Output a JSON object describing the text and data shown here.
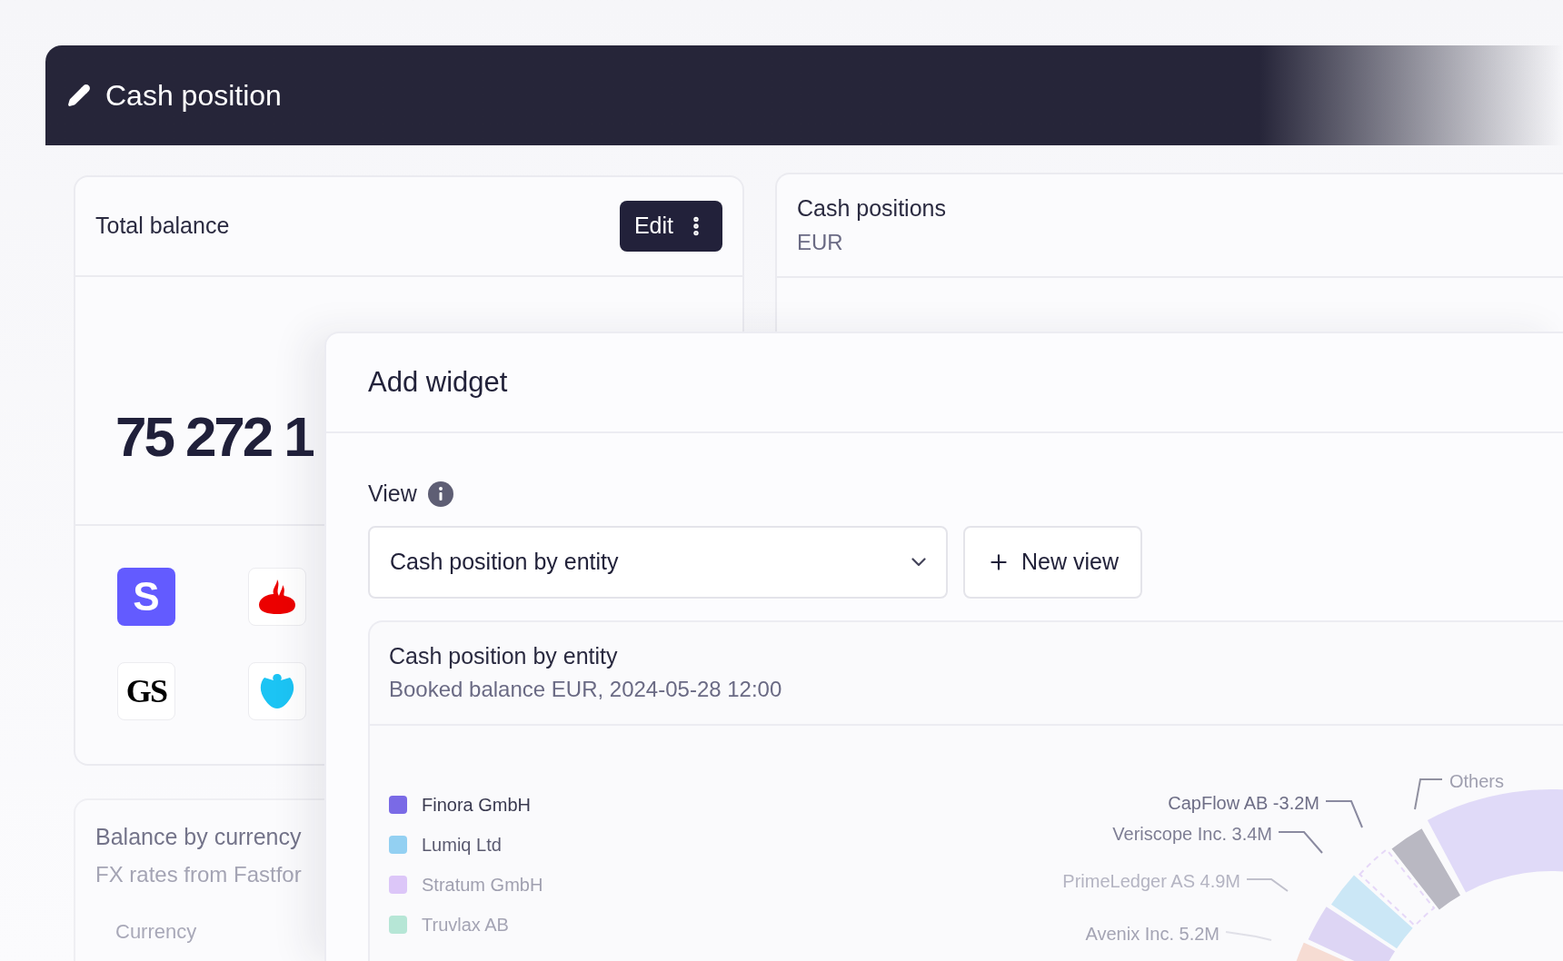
{
  "header": {
    "title": "Cash position"
  },
  "total_balance": {
    "title": "Total balance",
    "edit_button": "Edit",
    "amount": "75 272 1",
    "banks": [
      {
        "kind": "letter",
        "text": "S"
      },
      {
        "kind": "flame"
      },
      {
        "kind": "serif_letters",
        "text": "GS"
      },
      {
        "kind": "eagle"
      }
    ]
  },
  "balance_by_currency": {
    "title": "Balance by currency",
    "subtitle": "FX rates from Fastfor",
    "column_1": "Currency"
  },
  "cash_positions": {
    "title": "Cash positions",
    "subtitle": "EUR"
  },
  "modal": {
    "title": "Add widget",
    "view_label": "View",
    "view_select": "Cash position by entity",
    "new_view_button": "New view",
    "preview": {
      "title": "Cash position by entity",
      "subtitle": "Booked balance EUR, 2024-05-28 12:00",
      "legend": [
        {
          "name": "Finora GmbH",
          "color": "#7a6ae6"
        },
        {
          "name": "Lumiq Ltd",
          "color": "#93d0f2"
        },
        {
          "name": "Stratum GmbH",
          "color": "#dcc6f8"
        },
        {
          "name": "Truvlax AB",
          "color": "#b6e6d6"
        }
      ],
      "callouts": [
        {
          "label": "CapFlow AB -3.2M"
        },
        {
          "label": "Veriscope Inc. 3.4M"
        },
        {
          "label": "PrimeLedger AS 4.9M"
        },
        {
          "label": "Avenix Inc. 5.2M"
        },
        {
          "label": "Others"
        }
      ]
    }
  }
}
